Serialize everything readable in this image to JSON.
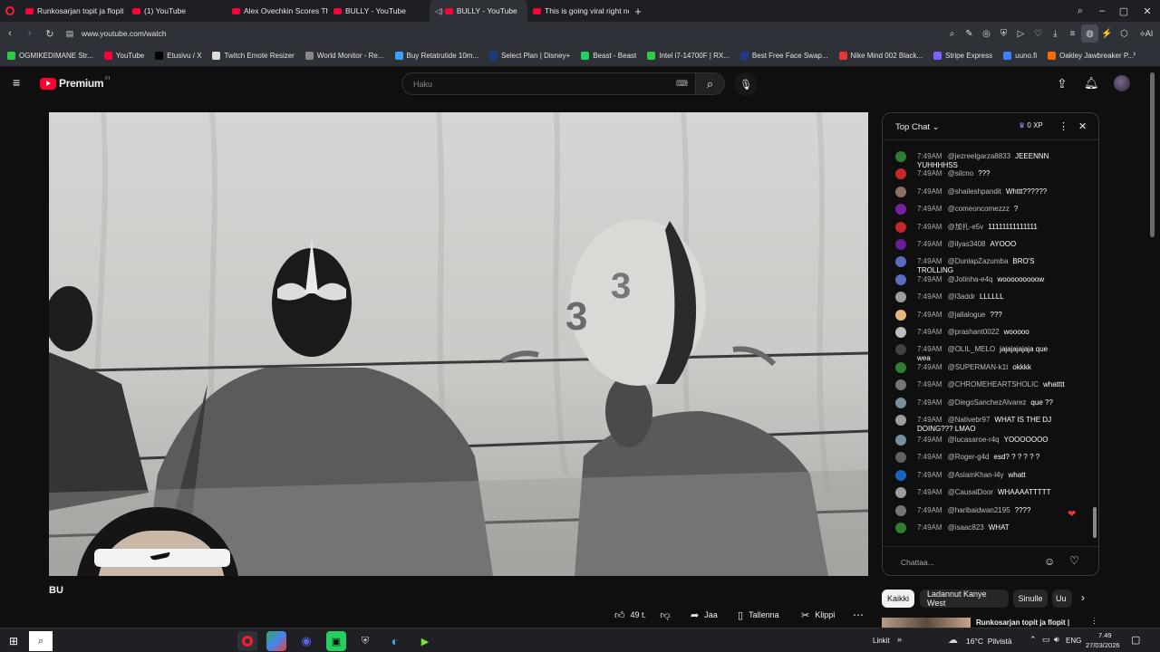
{
  "tabs": [
    {
      "label": "Runkosarjan topit ja flopit"
    },
    {
      "label": "(1) YouTube"
    },
    {
      "label": "Alex Ovechkin Scores Thre"
    },
    {
      "label": "BULLY - YouTube"
    },
    {
      "label": "BULLY - YouTube"
    },
    {
      "label": "This is going viral right no"
    }
  ],
  "address": {
    "url": "www.youtube.com/watch"
  },
  "bookmarks": [
    {
      "label": "OGMIKEDIMANE Str...",
      "color": "#2ecc40"
    },
    {
      "label": "YouTube",
      "color": "#ff0033"
    },
    {
      "label": "Etusivu / X",
      "color": "#000000"
    },
    {
      "label": "Twitch Emote Resizer",
      "color": "#dddddd"
    },
    {
      "label": "World Monitor - Re...",
      "color": "#888888"
    },
    {
      "label": "Buy Retatrutide 10m...",
      "color": "#3aa0ff"
    },
    {
      "label": "Select Plan | Disney+",
      "color": "#1a3a8a"
    },
    {
      "label": "Beast - Beast",
      "color": "#23d160"
    },
    {
      "label": "Intel i7-14700F | RX...",
      "color": "#2ecc40"
    },
    {
      "label": "Best Free Face Swap...",
      "color": "#1e3a8a"
    },
    {
      "label": "Nike Mind 002 Black...",
      "color": "#e53935"
    },
    {
      "label": "Stripe Express",
      "color": "#7b61ff"
    },
    {
      "label": "uuno.fi",
      "color": "#3b82f6"
    },
    {
      "label": "Oakley Jawbreaker P...",
      "color": "#ff6a00"
    }
  ],
  "youtube": {
    "logo_text": "Premium",
    "region": "FI",
    "search_placeholder": "Haku"
  },
  "video": {
    "title_fragment": "BU"
  },
  "chat": {
    "header": "Top Chat",
    "xp": "0 XP",
    "input_placeholder": "Chattaa...",
    "messages": [
      {
        "time": "7:49AM",
        "author": "@jezreelgarza8833",
        "text": "JEEENNN YUHHHHSS",
        "color": "#2e7d32"
      },
      {
        "time": "7:49AM",
        "author": "@silcno",
        "text": "???",
        "color": "#c62828"
      },
      {
        "time": "7:49AM",
        "author": "@shaileshpandit",
        "text": "Whttt??????",
        "color": "#8d6e63"
      },
      {
        "time": "7:49AM",
        "author": "@comeoncomezzz",
        "text": "?",
        "color": "#7b1fa2"
      },
      {
        "time": "7:49AM",
        "author": "@加扎-e5v",
        "text": "11111111111111",
        "color": "#c62828"
      },
      {
        "time": "7:49AM",
        "author": "@ilyas3408",
        "text": "AYOOO",
        "color": "#6a1b9a"
      },
      {
        "time": "7:49AM",
        "author": "@DunlapZazumba",
        "text": "BRO'S TROLLING",
        "color": "#5c6bc0"
      },
      {
        "time": "7:49AM",
        "author": "@Jotinha-e4q",
        "text": "wooooooooow",
        "color": "#5c6bc0"
      },
      {
        "time": "7:49AM",
        "author": "@l3addr",
        "text": "LLLLLL",
        "color": "#9e9e9e"
      },
      {
        "time": "7:49AM",
        "author": "@jallalogue",
        "text": "???",
        "color": "#e6b87a"
      },
      {
        "time": "7:49AM",
        "author": "@prashant0022",
        "text": "wooooo",
        "color": "#bdbdbd"
      },
      {
        "time": "7:49AM",
        "author": "@OLIL_MELO",
        "text": "jajajajajaja que wea",
        "color": "#424242"
      },
      {
        "time": "7:49AM",
        "author": "@SUPERMAN-k1t",
        "text": "okkkk",
        "color": "#2e7d32"
      },
      {
        "time": "7:49AM",
        "author": "@CHROMEHEARTSHOLIC",
        "text": "whatttt",
        "color": "#757575"
      },
      {
        "time": "7:49AM",
        "author": "@DiegoSanchezAlvarez",
        "text": "que ??",
        "color": "#78909c"
      },
      {
        "time": "7:49AM",
        "author": "@Nativebr97",
        "text": "WHAT IS THE DJ DOING??? LMAO",
        "color": "#9e9e9e"
      },
      {
        "time": "7:49AM",
        "author": "@lucasaroe-r4q",
        "text": "YOOOOOOO",
        "color": "#78909c"
      },
      {
        "time": "7:49AM",
        "author": "@Roger-g4d",
        "text": "esd? ? ? ? ? ?",
        "color": "#616161"
      },
      {
        "time": "7:49AM",
        "author": "@AslamKhan-l4y",
        "text": "whatt",
        "color": "#1565c0"
      },
      {
        "time": "7:49AM",
        "author": "@CausalDoor",
        "text": "WHAAAATTTTT",
        "color": "#9e9e9e"
      },
      {
        "time": "7:49AM",
        "author": "@haribaidwan2195",
        "text": "????",
        "color": "#757575"
      },
      {
        "time": "7:49AM",
        "author": "@isaac823",
        "text": "WHAT",
        "color": "#2e7d32"
      }
    ]
  },
  "actions": {
    "likes": "49 t.",
    "share": "Jaa",
    "save": "Tallenna",
    "clip": "Klippi"
  },
  "chips": [
    {
      "label": "Kaikki",
      "selected": true
    },
    {
      "label": "Ladannut Kanye West",
      "selected": false
    },
    {
      "label": "Sinulle",
      "selected": false
    },
    {
      "label": "Uu",
      "selected": false
    }
  ],
  "related": {
    "title": "Runkosarjan topit ja flopit |"
  },
  "taskbar": {
    "links": "Linkit",
    "weather": "16°C  Pilvistä",
    "lang": "ENG",
    "time": "7.49",
    "date": "27/03/2026"
  }
}
